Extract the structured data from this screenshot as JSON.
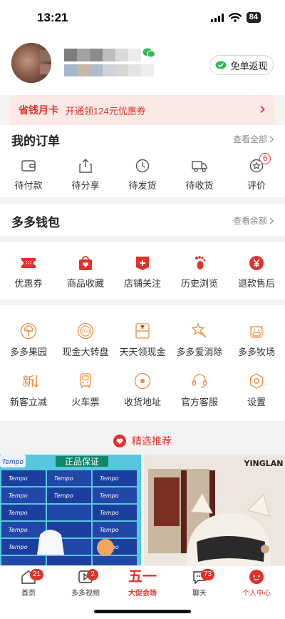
{
  "status_bar": {
    "time": "13:21",
    "battery": "84"
  },
  "profile": {
    "refund_button": "免单返现"
  },
  "save_card": {
    "title": "省钱月卡",
    "offer": "开通领124元优惠券"
  },
  "orders": {
    "title": "我的订单",
    "view_all": "查看全部",
    "items": [
      {
        "label": "待付款",
        "icon": "wallet-icon"
      },
      {
        "label": "待分享",
        "icon": "share-icon"
      },
      {
        "label": "待发货",
        "icon": "clock-icon"
      },
      {
        "label": "待收货",
        "icon": "truck-icon"
      },
      {
        "label": "评价",
        "icon": "review-star-icon",
        "badge": "6"
      }
    ]
  },
  "wallet": {
    "title": "多多钱包",
    "view_balance": "查看余额"
  },
  "quick_links": [
    {
      "label": "优惠券",
      "icon": "coupon-icon"
    },
    {
      "label": "商品收藏",
      "icon": "bag-heart-icon"
    },
    {
      "label": "店铺关注",
      "icon": "shop-follow-icon"
    },
    {
      "label": "历史浏览",
      "icon": "footprint-icon"
    },
    {
      "label": "退款售后",
      "icon": "yen-refund-icon"
    }
  ],
  "services": [
    {
      "label": "多多果园",
      "icon": "tree-icon"
    },
    {
      "label": "现金大转盘",
      "icon": "wheel-icon"
    },
    {
      "label": "天天领现金",
      "icon": "cash-envelope-icon"
    },
    {
      "label": "多多爱消除",
      "icon": "star-wand-icon"
    },
    {
      "label": "多多牧场",
      "icon": "cow-icon"
    },
    {
      "label": "新客立减",
      "icon": "new-customer-icon"
    },
    {
      "label": "火车票",
      "icon": "train-icon"
    },
    {
      "label": "收货地址",
      "icon": "location-icon"
    },
    {
      "label": "官方客服",
      "icon": "headset-icon"
    },
    {
      "label": "设置",
      "icon": "settings-icon"
    }
  ],
  "recommend": {
    "title": "精选推荐"
  },
  "products": [
    {
      "brand": "Tempo",
      "tag": "正品保证"
    },
    {
      "brand": "YINGLAN"
    }
  ],
  "tabbar": [
    {
      "label": "首页",
      "badge": "21",
      "icon": "home-icon"
    },
    {
      "label": "多多视频",
      "badge": "2",
      "icon": "video-icon"
    },
    {
      "label": "大促会场",
      "big": "五一",
      "icon": "promo-icon"
    },
    {
      "label": "聊天",
      "badge": "73",
      "icon": "chat-icon"
    },
    {
      "label": "个人中心",
      "icon": "profile-icon",
      "active": true
    }
  ],
  "colors": {
    "accent": "#e0322a",
    "orange": "#f08a3c",
    "card_bg": "#fbe9e6"
  }
}
